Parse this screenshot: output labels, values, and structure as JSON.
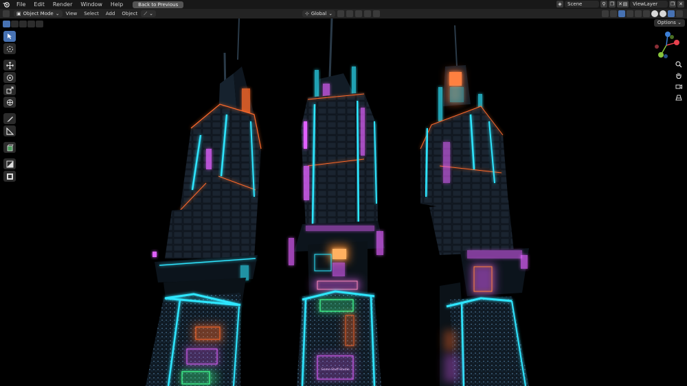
{
  "menubar": {
    "items": [
      "File",
      "Edit",
      "Render",
      "Window",
      "Help"
    ],
    "back_button": "Back to Previous",
    "scene_name": "Scene",
    "view_layer": "ViewLayer"
  },
  "viewport_header": {
    "mode": "Object Mode",
    "menus": [
      "View",
      "Select",
      "Add",
      "Object"
    ],
    "transform_orientation": "Global"
  },
  "options_label": "Options",
  "toolbar": {
    "tools": [
      "select-box-icon",
      "cursor-icon",
      "move-icon",
      "rotate-icon",
      "scale-icon",
      "transform-icon",
      "annotate-icon",
      "measure-icon",
      "add-cube-icon",
      "shade-icon",
      "texture-icon"
    ]
  },
  "gizmo": {
    "axis_colors": {
      "x": "#e8414e",
      "y": "#88c43b",
      "z": "#3c7fd6"
    }
  },
  "scene": {
    "signs": [
      "Game Stuff Studio"
    ],
    "colors": {
      "cyan": "#2ee6ff",
      "orange": "#ff6a2a",
      "magenta": "#e060ff",
      "green": "#40ff90"
    }
  }
}
